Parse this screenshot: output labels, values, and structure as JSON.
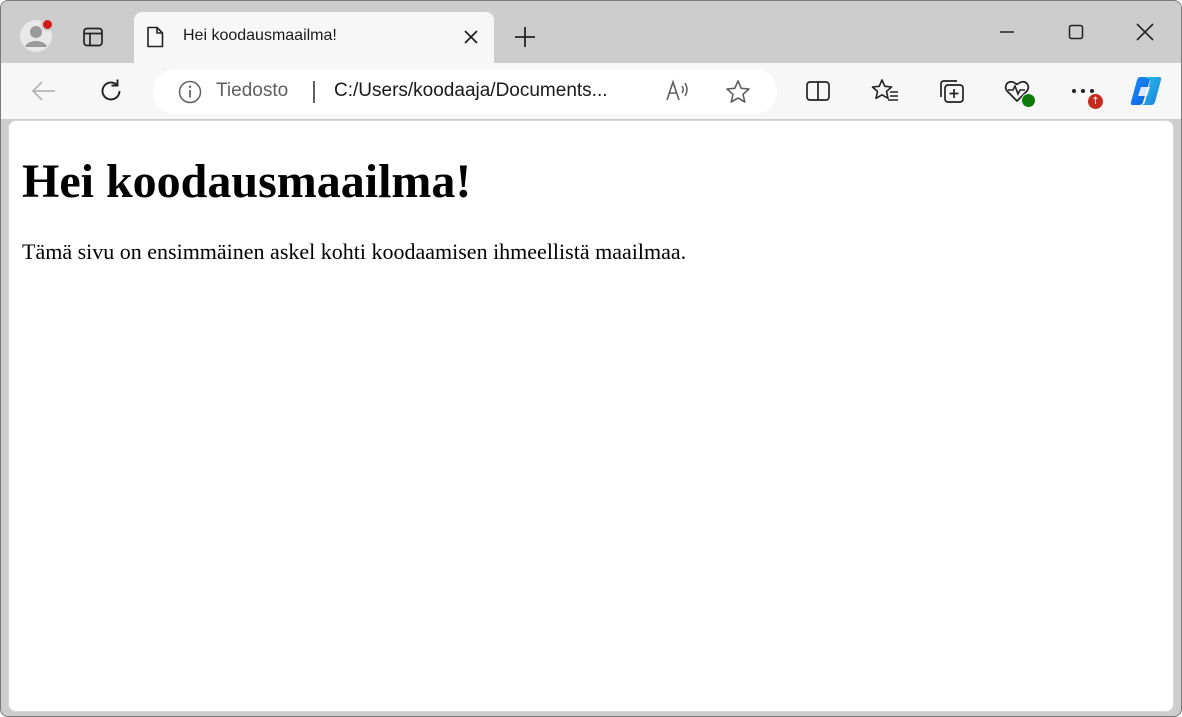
{
  "tab": {
    "title": "Hei koodausmaailma!"
  },
  "address_bar": {
    "site_label": "Tiedosto",
    "url": "C:/Users/koodaaja/Documents..."
  },
  "page": {
    "heading": "Hei koodausmaailma!",
    "paragraph": "Tämä sivu on ensimmäinen askel kohti koodaamisen ihmeellistä maailmaa."
  },
  "colors": {
    "tabstrip_bg": "#cdcdcd",
    "toolbar_bg": "#f7f7f7",
    "profile_notification": "#d31a1a",
    "update_badge": "#c42b1c",
    "health_badge": "#0f7b0f"
  },
  "icons": {
    "profile": "avatar-icon",
    "tab_actions": "tab-actions-icon",
    "page": "page-icon",
    "close_tab": "close-icon",
    "new_tab": "plus-icon",
    "minimize": "minimize-icon",
    "maximize": "maximize-icon",
    "close_window": "close-icon",
    "back": "back-arrow-icon",
    "refresh": "refresh-icon",
    "site_info": "info-icon",
    "read_aloud": "read-aloud-icon",
    "favorite": "star-icon",
    "split_screen": "split-screen-icon",
    "favorites": "favorites-icon",
    "collections": "collections-icon",
    "browser_essentials": "heart-pulse-icon",
    "more": "more-icon",
    "copilot": "copilot-icon"
  }
}
